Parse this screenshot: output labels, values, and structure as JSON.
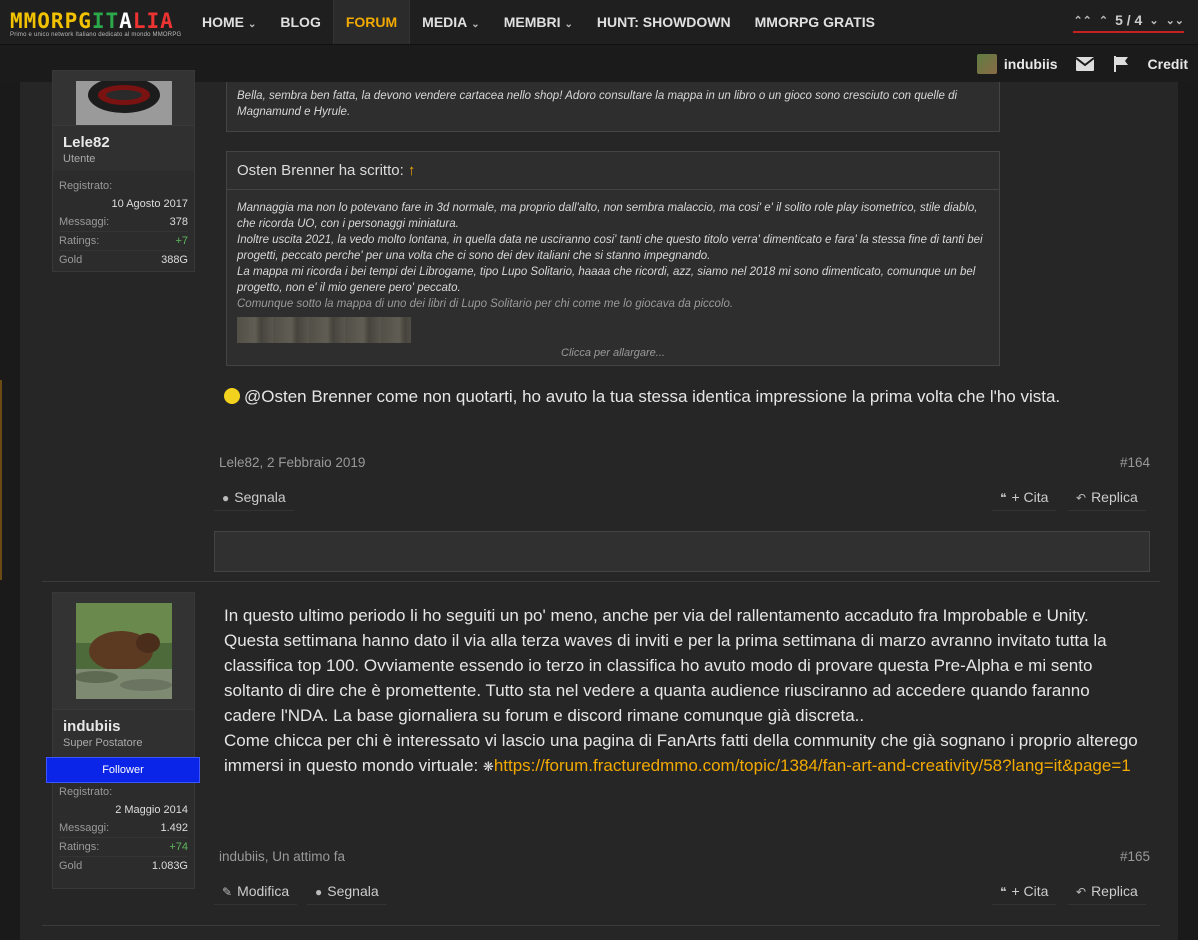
{
  "site": {
    "logo_parts": [
      "MMORPG",
      "IT",
      "A",
      "L",
      "IA"
    ],
    "tagline": "Primo e unico network Italiano dedicato al mondo MMORPG"
  },
  "nav": {
    "items": [
      {
        "label": "HOME",
        "caret": true
      },
      {
        "label": "BLOG",
        "caret": false
      },
      {
        "label": "FORUM",
        "caret": false,
        "active": true
      },
      {
        "label": "MEDIA",
        "caret": true
      },
      {
        "label": "MEMBRI",
        "caret": true
      },
      {
        "label": "HUNT: SHOWDOWN",
        "caret": false
      },
      {
        "label": "MMORPG GRATIS",
        "caret": false
      }
    ],
    "pager": "5 / 4"
  },
  "subbar": {
    "username": "indubiis",
    "credit_label": "Credit"
  },
  "post1": {
    "user": {
      "name": "Lele82",
      "title": "Utente",
      "registered_label": "Registrato:",
      "registered_value": "10 Agosto 2017",
      "messages_label": "Messaggi:",
      "messages_value": "378",
      "ratings_label": "Ratings:",
      "ratings_value": "+7",
      "gold_label": "Gold",
      "gold_value": "388G"
    },
    "quote1_text": "Bella, sembra ben fatta, la devono vendere cartacea nello shop! Adoro consultare la mappa in un libro o un gioco sono cresciuto con quelle di Magnamund e Hyrule.",
    "quote2": {
      "author": "Osten Brenner ha scritto:",
      "arrow": "↑",
      "lines": [
        "Mannaggia ma non lo potevano fare in 3d normale, ma proprio dall'alto, non sembra malaccio, ma cosi' e' il solito role play isometrico, stile diablo, che ricorda UO, con i personaggi miniatura.",
        "Inoltre uscita 2021, la vedo molto lontana, in quella data ne usciranno cosi' tanti che questo titolo verra' dimenticato e fara' la stessa fine di tanti bei progetti, peccato perche' per una volta che ci sono dei dev italiani che si stanno impegnando.",
        "La mappa mi ricorda i bei tempi dei Librogame, tipo Lupo Solitario, haaaa che ricordi, azz, siamo nel 2018 mi sono dimenticato, comunque un bel progetto, non e' il mio genere pero' peccato.",
        "Comunque sotto la mappa di uno dei libri di Lupo Solitario per chi come me lo giocava da piccolo."
      ],
      "expand": "Clicca per allargare..."
    },
    "body": "@Osten Brenner come non quotarti, ho avuto la tua stessa identica impressione la prima volta che l'ho vista.",
    "meta": "Lele82, 2 Febbraio 2019",
    "number": "#164",
    "actions": {
      "report": "Segnala",
      "quote": "+ Cita",
      "reply": "Replica"
    }
  },
  "post2": {
    "user": {
      "name": "indubiis",
      "title": "Super Postatore",
      "badge": "Follower",
      "registered_label": "Registrato:",
      "registered_value": "2 Maggio 2014",
      "messages_label": "Messaggi:",
      "messages_value": "1.492",
      "ratings_label": "Ratings:",
      "ratings_value": "+74",
      "gold_label": "Gold",
      "gold_value": "1.083G"
    },
    "body": "In questo ultimo periodo li ho seguiti un po' meno, anche per via del rallentamento accaduto fra Improbable e Unity. Questa settimana hanno dato il via alla terza waves di inviti e per la prima settimana di marzo avranno invitato tutta la classifica top 100. Ovviamente essendo io terzo in classifica ho avuto modo di provare questa Pre-Alpha e mi sento soltanto di dire che è promettente. Tutto sta nel vedere a quanta audience riusciranno ad accedere quando faranno cadere l'NDA. La base giornaliera su forum e discord rimane comunque già discreta..",
    "body2": "Come chicca per chi è interessato vi lascio una pagina di FanArts fatti della community che già sognano i proprio alterego immersi in questo mondo virtuale:",
    "link": "https://forum.fracturedmmo.com/topic/1384/fan-art-and-creativity/58?lang=it&page=1",
    "meta": "indubiis, Un attimo fa",
    "number": "#165",
    "actions": {
      "edit": "Modifica",
      "report": "Segnala",
      "quote": "+ Cita",
      "reply": "Replica"
    }
  },
  "colors": {
    "accent": "#f2a900",
    "follower": "#0a24e8",
    "positive": "#5cb85c"
  }
}
